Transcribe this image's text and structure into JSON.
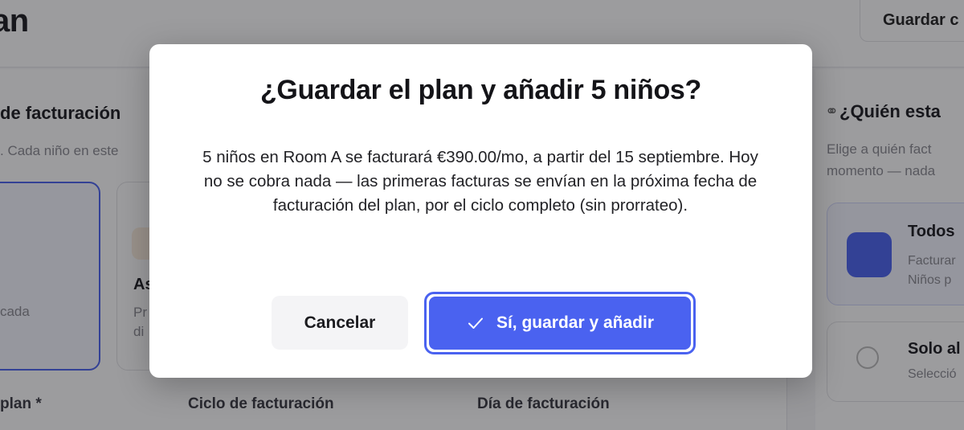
{
  "background": {
    "page_title": "an",
    "save_button_label": "Guardar c",
    "section_title": "de facturación",
    "section_subtitle": ". Cada niño en este",
    "mode_card_1_desc": "lo cada",
    "mode_card_2_title": "As",
    "mode_card_2_desc_1": "Pr",
    "mode_card_2_desc_2": "di",
    "field_plan_label": "plan *",
    "field_cycle_label": "Ciclo de facturación",
    "field_day_label": "Día de facturación",
    "right_panel": {
      "title": "¿Quién esta",
      "subtitle_1": "Elige a quién fact",
      "subtitle_2": "momento — nada",
      "option_all_title": "Todos",
      "option_all_desc_1": "Facturar",
      "option_all_desc_2": "Niños p",
      "option_some_title": "Solo al",
      "option_some_desc": "Selecció"
    }
  },
  "modal": {
    "title": "¿Guardar el plan y añadir 5 niños?",
    "body": "5 niños en Room A se facturará €390.00/mo, a partir del 15 septiembre. Hoy no se cobra nada — las primeras facturas se envían en la próxima fecha de facturación del plan, por el ciclo completo (sin prorrateo).",
    "cancel_label": "Cancelar",
    "confirm_label": "Sí, guardar y añadir",
    "confirm_icon": "check-icon"
  },
  "colors": {
    "accent": "#4a62f0",
    "overlay": "rgba(20,20,24,0.42)"
  }
}
